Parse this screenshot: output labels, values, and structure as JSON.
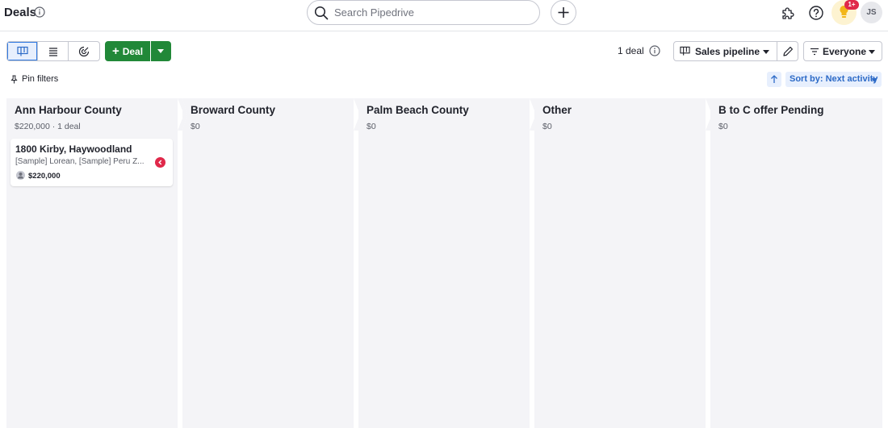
{
  "header": {
    "title": "Deals",
    "search_placeholder": "Search Pipedrive",
    "notification_badge": "1+",
    "avatar_initials": "JS"
  },
  "toolbar": {
    "views": [
      "pipeline-view",
      "list-view",
      "forecast-view"
    ],
    "active_view": "pipeline-view",
    "add_deal_label": "Deal",
    "deal_count": "1 deal",
    "pipeline_label": "Sales pipeline",
    "owner_filter_label": "Everyone"
  },
  "filters": {
    "pin_label": "Pin filters",
    "sort_label": "Sort by: Next activity"
  },
  "stages": [
    {
      "name": "Ann Harbour County",
      "summary": "$220,000 · 1 deal"
    },
    {
      "name": "Broward County",
      "summary": "$0"
    },
    {
      "name": "Palm Beach County",
      "summary": "$0"
    },
    {
      "name": "Other",
      "summary": "$0"
    },
    {
      "name": "B to C offer Pending",
      "summary": "$0"
    }
  ],
  "deal": {
    "title": "1800 Kirby, Haywoodland",
    "people": "[Sample] Lorean, [Sample] Peru Z...",
    "value": "$220,000",
    "status_color": "#e0284a"
  },
  "colors": {
    "accent_green": "#218838",
    "accent_blue": "#317ae2",
    "stage_bg": "#f4f4f7"
  }
}
